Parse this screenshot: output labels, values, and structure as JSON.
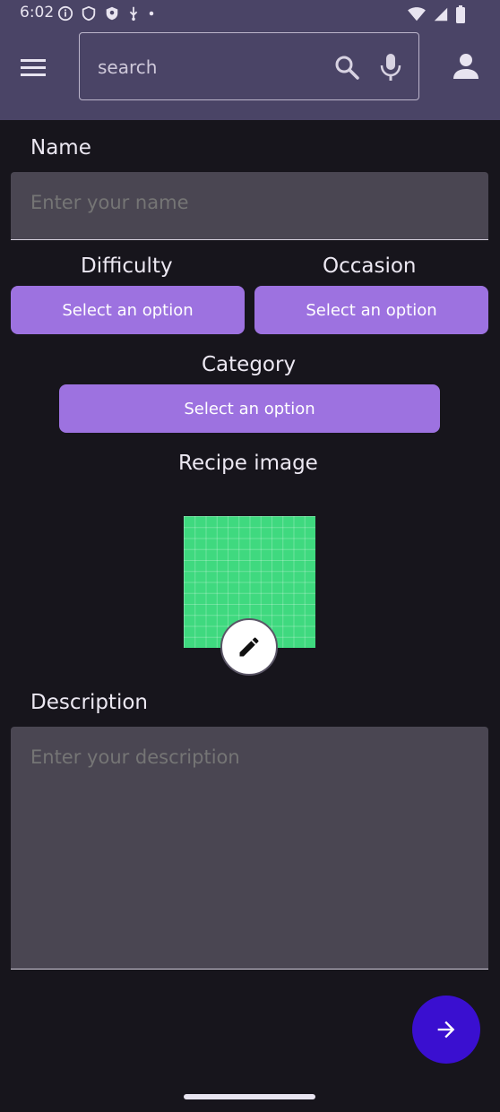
{
  "status_bar": {
    "time": "6:02",
    "icons_left": [
      "info-icon",
      "shield-icon",
      "shield-filled-icon",
      "usb-icon",
      "dot-icon"
    ],
    "icons_right": [
      "wifi-icon",
      "signal-icon",
      "battery-icon"
    ]
  },
  "header": {
    "menu_icon": "menu-icon",
    "search": {
      "placeholder": "search",
      "value": ""
    },
    "search_icon": "search-icon",
    "mic_icon": "mic-icon",
    "account_icon": "account-icon"
  },
  "form": {
    "name_label": "Name",
    "name_placeholder": "Enter your name",
    "difficulty_label": "Difficulty",
    "difficulty_select": "Select an option",
    "occasion_label": "Occasion",
    "occasion_select": "Select an option",
    "category_label": "Category",
    "category_select": "Select an option",
    "recipe_image_label": "Recipe image",
    "edit_icon": "pencil-icon",
    "description_label": "Description",
    "description_placeholder": "Enter your description",
    "next_icon": "arrow-right-icon"
  },
  "colors": {
    "header_bg": "#4a4466",
    "page_bg": "#17151c",
    "select_button": "#9d72e0",
    "image_fill": "#3fd97f",
    "fab": "#3a0fd0"
  }
}
